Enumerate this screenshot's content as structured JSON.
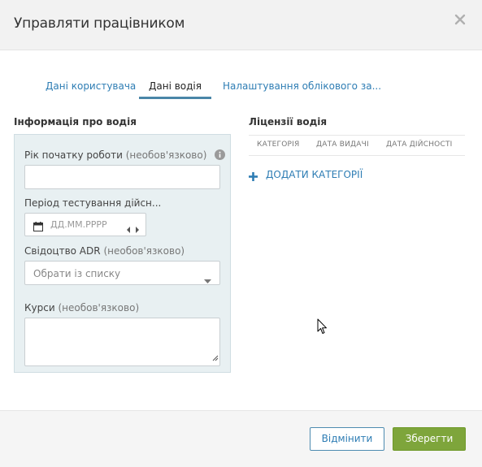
{
  "modal": {
    "title": "Управляти працівником"
  },
  "tabs": [
    {
      "label": "Дані користувача",
      "active": false
    },
    {
      "label": "Дані водія",
      "active": true
    },
    {
      "label": "Налаштування облікового за..."
    }
  ],
  "driver_info": {
    "title": "Інформація про водія",
    "work_start_year": {
      "label": "Рік початку роботи",
      "optional": "(необов'язково)",
      "value": ""
    },
    "test_period": {
      "label": "Період тестування дійсн...",
      "placeholder": "ДД.ММ.РРРР"
    },
    "adr": {
      "label": "Свідоцтво ADR",
      "optional": "(необов'язково)",
      "selected": "Обрати із списку"
    },
    "courses": {
      "label": "Курси",
      "optional": "(необов'язково)",
      "value": ""
    }
  },
  "licenses": {
    "title": "Ліцензії водія",
    "columns": [
      "КАТЕГОРІЯ",
      "ДАТА ВИДАЧІ",
      "ДАТА ДІЙСНОСТІ"
    ],
    "add_label": "ДОДАТИ КАТЕГОРІЇ"
  },
  "footer": {
    "cancel_label": "Відмінити",
    "save_label": "Зберегти"
  },
  "icons": {
    "close": "close-icon",
    "info": "info-icon",
    "calendar": "calendar-icon",
    "arrows": "left-right-arrows-icon",
    "caret": "chevron-down-icon",
    "plus": "plus-icon"
  },
  "colors": {
    "accent": "#2e7db4",
    "save": "#7ea53b",
    "panel": "#e8f0f2"
  }
}
